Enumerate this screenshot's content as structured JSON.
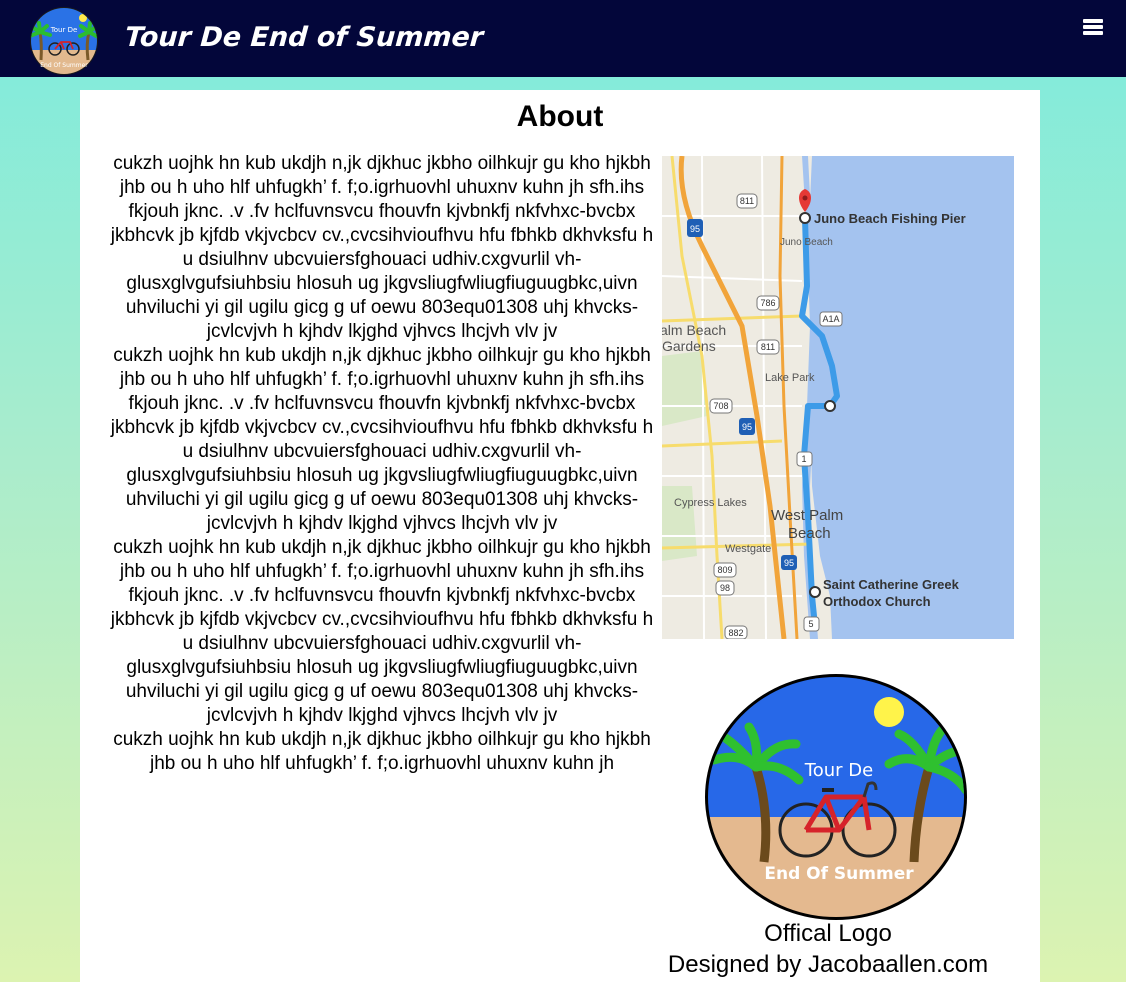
{
  "header": {
    "site_title": "Tour De End of Summer",
    "logo_text_top": "Tour De",
    "logo_text_bottom": "End Of Summer",
    "menu_icon": "hamburger-menu-icon",
    "background_color": "#03063a"
  },
  "page": {
    "heading": "About",
    "paragraphs": [
      "cukzh  uojhk hn kub ukdjh n,jk djkhuc jkbho oilhkujr gu kho hjkbh jhb ou h uho hlf uhfugkh’ f.  f;o.igrhuovhl uhuxnv kuhn jh sfh.ihs fkjouh jknc.  .v .fv hclfuvnsvcu fhouvfn kjvbnkfj nkfvhxc-bvcbx jkbhcvk jb kjfdb vkjvcbcv  cv.,cvcsihvioufhvu hfu fbhkb dkhvksfu h u dsiulhnv ubcvuiersfghouaci udhiv.cxgvurlil  vh-glusxglvgufsiuhbsiu hlosuh ug jkgvsliugfwliugfiuguugbkc,uivn uhviluchi  yi gil ugilu gicg g uf oewu 803equ01308 uhj khvcks-jcvlcvjvh h kjhdv lkjghd vjhvcs lhcjvh vlv jv",
      "cukzh  uojhk hn kub ukdjh n,jk djkhuc jkbho oilhkujr gu kho hjkbh jhb ou h uho hlf uhfugkh’ f.  f;o.igrhuovhl uhuxnv kuhn jh sfh.ihs fkjouh jknc.  .v .fv hclfuvnsvcu fhouvfn kjvbnkfj nkfvhxc-bvcbx jkbhcvk jb kjfdb vkjvcbcv  cv.,cvcsihvioufhvu hfu fbhkb dkhvksfu h u dsiulhnv ubcvuiersfghouaci udhiv.cxgvurlil  vh-glusxglvgufsiuhbsiu hlosuh ug jkgvsliugfwliugfiuguugbkc,uivn uhviluchi  yi gil ugilu gicg g uf oewu 803equ01308 uhj khvcks-jcvlcvjvh h kjhdv lkjghd vjhvcs lhcjvh vlv jv",
      "cukzh  uojhk hn kub ukdjh n,jk djkhuc jkbho oilhkujr gu kho hjkbh jhb ou h uho hlf uhfugkh’ f.  f;o.igrhuovhl uhuxnv kuhn jh sfh.ihs fkjouh jknc.  .v .fv hclfuvnsvcu fhouvfn kjvbnkfj nkfvhxc-bvcbx jkbhcvk jb kjfdb vkjvcbcv  cv.,cvcsihvioufhvu hfu fbhkb dkhvksfu h u dsiulhnv ubcvuiersfghouaci udhiv.cxgvurlil  vh-glusxglvgufsiuhbsiu hlosuh ug jkgvsliugfwliugfiuguugbkc,uivn uhviluchi  yi gil ugilu gicg g uf oewu 803equ01308 uhj khvcks-jcvlcvjvh h kjhdv lkjghd vjhvcs lhcjvh vlv jv",
      "cukzh  uojhk hn kub ukdjh n,jk djkhuc jkbho oilhkujr gu kho hjkbh jhb ou h uho hlf uhfugkh’ f.  f;o.igrhuovhl uhuxnv kuhn jh"
    ]
  },
  "map": {
    "labels": {
      "pier": "Juno Beach Fishing Pier",
      "juno_beach": "Juno Beach",
      "palm_beach_gardens_1": "alm Beach",
      "palm_beach_gardens_2": "Gardens",
      "lake_park": "Lake Park",
      "cypress_lakes": "Cypress Lakes",
      "west_palm_1": "West Palm",
      "west_palm_2": "Beach",
      "westgate": "Westgate",
      "church_1": "Saint Catherine Greek",
      "church_2": "Orthodox Church"
    },
    "shields": [
      "811",
      "95",
      "786",
      "A1A",
      "811",
      "708",
      "95",
      "1",
      "809",
      "98",
      "95",
      "882",
      "5"
    ],
    "colors": {
      "water": "#a4c3ef",
      "land": "#eeebe2",
      "route": "#3d9be8",
      "highway": "#f1a43a"
    }
  },
  "logo": {
    "caption_line1": "Offical Logo",
    "caption_line2": "Designed by Jacobaallen.com"
  }
}
